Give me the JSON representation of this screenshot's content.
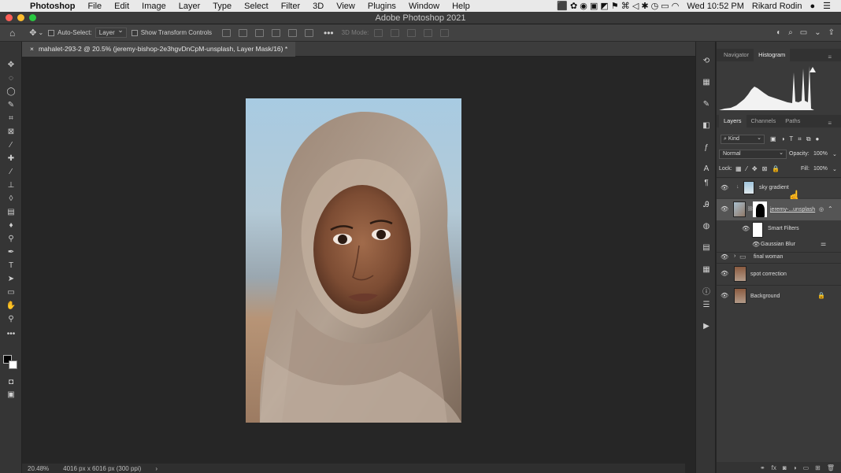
{
  "menubar": {
    "app": "Photoshop",
    "items": [
      "File",
      "Edit",
      "Image",
      "Layer",
      "Type",
      "Select",
      "Filter",
      "3D",
      "View",
      "Plugins",
      "Window",
      "Help"
    ],
    "clock": "Wed 10:52 PM",
    "user": "Rikard Rodin"
  },
  "window": {
    "title": "Adobe Photoshop 2021"
  },
  "options": {
    "auto_select_label": "Auto-Select:",
    "auto_select_value": "Layer",
    "transform_label": "Show Transform Controls",
    "mode3d_label": "3D Mode:"
  },
  "document": {
    "tab_title": "mahalet-293-2 @ 20.5% (jeremy-bishop-2e3hgvDnCpM-unsplash, Layer Mask/16) *",
    "zoom": "20.48%",
    "dimensions": "4016 px x 6016 px (300 ppi)",
    "status_arrow": "›"
  },
  "top_panel": {
    "tabs": [
      "Navigator",
      "Histogram"
    ],
    "active": "Histogram"
  },
  "layers_panel": {
    "tabs": [
      "Layers",
      "Channels",
      "Paths"
    ],
    "active": "Layers",
    "filter_kind": "Kind",
    "blend_mode": "Normal",
    "opacity_label": "Opacity:",
    "opacity_value": "100%",
    "lock_label": "Lock:",
    "fill_label": "Fill:",
    "fill_value": "100%",
    "layers": [
      {
        "name": "sky gradient"
      },
      {
        "name": "jeremy-...unsplash"
      },
      {
        "name": "Smart Filters"
      },
      {
        "name": "Gaussian Blur"
      },
      {
        "name": "final woman"
      },
      {
        "name": "spot correction"
      },
      {
        "name": "Background"
      }
    ]
  },
  "colors": {
    "accent": "#2d6bd9",
    "sky": "#a9cbe1",
    "scarf": "#9a8775",
    "skin": "#8a5a3f"
  }
}
